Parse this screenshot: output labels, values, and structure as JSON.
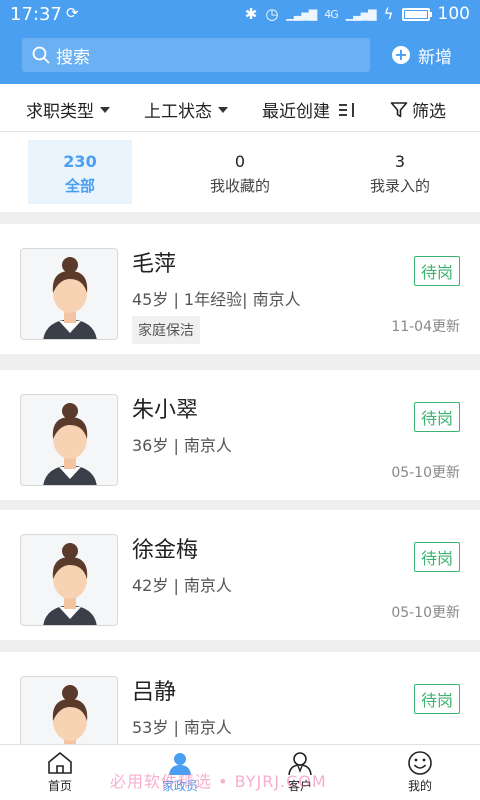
{
  "status_bar": {
    "time": "17:37",
    "network_label": "4G",
    "battery": "100",
    "battery_level": 1.0
  },
  "header": {
    "search_placeholder": "搜索",
    "add_label": "新增"
  },
  "filters": {
    "job_type": "求职类型",
    "work_status": "上工状态",
    "sort": "最近创建",
    "screen": "筛选"
  },
  "tabs": [
    {
      "count": "230",
      "label": "全部"
    },
    {
      "count": "0",
      "label": "我收藏的"
    },
    {
      "count": "3",
      "label": "我录入的"
    }
  ],
  "workers": [
    {
      "name": "毛萍",
      "info": "45岁 | 1年经验| 南京人",
      "tag": "家庭保洁",
      "status": "待岗",
      "updated": "11-04更新"
    },
    {
      "name": "朱小翠",
      "info": "36岁 | 南京人",
      "status": "待岗",
      "updated": "05-10更新"
    },
    {
      "name": "徐金梅",
      "info": "42岁 | 南京人",
      "status": "待岗",
      "updated": "05-10更新"
    },
    {
      "name": "吕静",
      "info": "53岁 | 南京人",
      "status": "待岗"
    }
  ],
  "bottom_nav": [
    {
      "label": "首页"
    },
    {
      "label": "家政员"
    },
    {
      "label": "客户"
    },
    {
      "label": "我的"
    }
  ],
  "watermark": "必用软件精选 • BYJRJ.COM",
  "colors": {
    "primary": "#4a9ff0",
    "status_green": "#3cb371"
  }
}
